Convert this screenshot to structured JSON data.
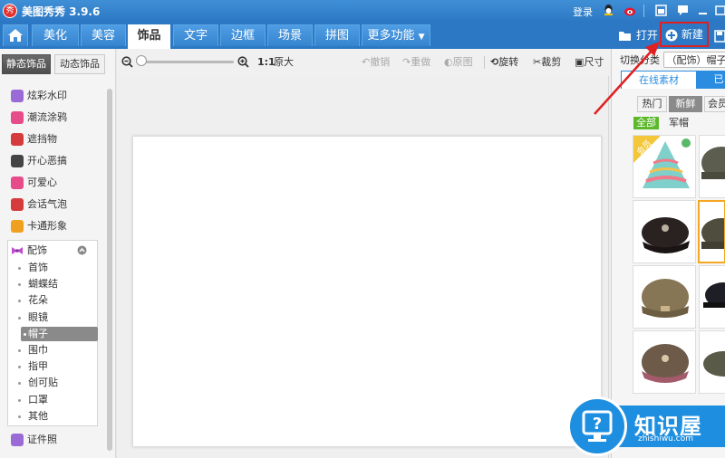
{
  "titlebar": {
    "title": "美图秀秀 3.9.6",
    "logo_text": "秀",
    "login": "登录"
  },
  "nav": {
    "tabs": [
      "美化",
      "美容",
      "饰品",
      "文字",
      "边框",
      "场景",
      "拼图",
      "更多功能"
    ],
    "active": "饰品",
    "open_label": "打开",
    "new_label": "新建"
  },
  "sidebar": {
    "tabs": [
      "静态饰品",
      "动态饰品"
    ],
    "items": [
      "炫彩水印",
      "潮流涂鸦",
      "遮挡物",
      "开心恶搞",
      "可爱心",
      "会话气泡",
      "卡通形象"
    ],
    "expanded": {
      "label": "配饰",
      "subs": [
        "首饰",
        "蝴蝶结",
        "花朵",
        "眼镜",
        "帽子",
        "围巾",
        "指甲",
        "创可贴",
        "口罩",
        "其他"
      ],
      "active": "帽子"
    },
    "after": [
      "证件照"
    ],
    "item_colors": [
      "#9a6bd6",
      "#e64b8a",
      "#d63b3b",
      "#444444",
      "#e64b8a",
      "#d63b3b",
      "#f0a020"
    ]
  },
  "toolbar": {
    "actual_size": "1:1",
    "original_size": "原大",
    "undo": "撤销",
    "redo": "重做",
    "original": "原图",
    "rotate": "旋转",
    "crop": "裁剪",
    "resize": "尺寸"
  },
  "right_panel": {
    "switch_label": "切换分类",
    "category": "（配饰）帽子",
    "tabs": [
      "在线素材",
      "已"
    ],
    "sub_tabs": [
      "热门",
      "新鲜",
      "会员"
    ],
    "active_sub": "新鲜",
    "filters": [
      "全部",
      "军帽"
    ],
    "badge": "会员"
  },
  "watermark": {
    "title": "知识屋",
    "url": "zhishiwu.com"
  },
  "colors": {
    "brand_blue": "#2c78c4",
    "highlight_red": "#e02020",
    "accent_green": "#5cb82a"
  }
}
